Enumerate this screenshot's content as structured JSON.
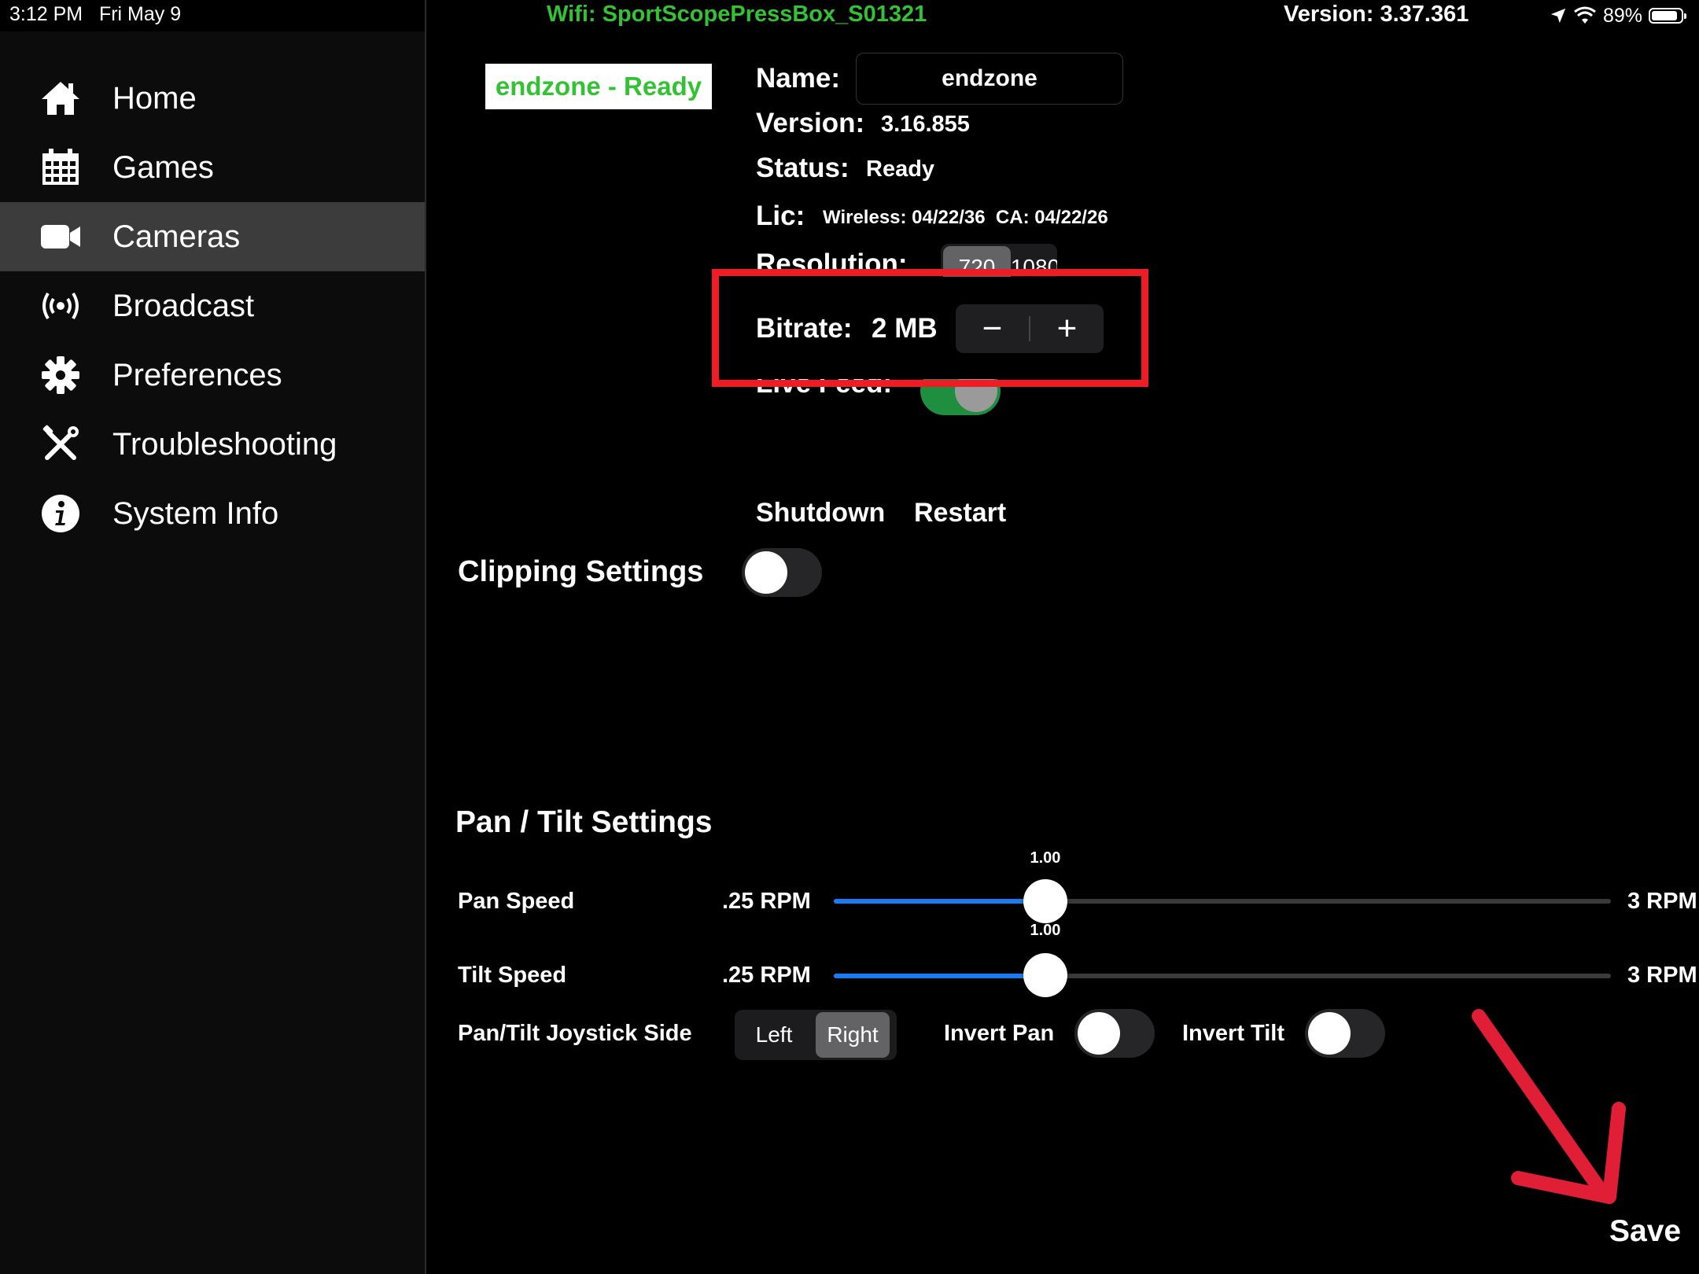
{
  "status_bar": {
    "time": "3:12 PM",
    "date": "Fri May 9",
    "wifi": "Wifi: SportScopePressBox_S01321",
    "version": "Version: 3.37.361",
    "battery": "89%",
    "battery_level": 0.89,
    "icons": [
      "location-arrow-icon",
      "wifi-icon",
      "battery-icon"
    ]
  },
  "sidebar": {
    "items": [
      {
        "label": "Home",
        "icon": "home-icon"
      },
      {
        "label": "Games",
        "icon": "calendar-icon"
      },
      {
        "label": "Cameras",
        "icon": "camera-icon",
        "active": true
      },
      {
        "label": "Broadcast",
        "icon": "broadcast-icon"
      },
      {
        "label": "Preferences",
        "icon": "gear-icon"
      },
      {
        "label": "Troubleshooting",
        "icon": "tools-icon"
      },
      {
        "label": "System Info",
        "icon": "info-icon"
      }
    ]
  },
  "camera": {
    "badge": "endzone - Ready",
    "name_label": "Name:",
    "name_value": "endzone",
    "version_label": "Version:",
    "version_value": "3.16.855",
    "status_label": "Status:",
    "status_value": "Ready",
    "lic_label": "Lic:",
    "lic_value": "Wireless: 04/22/36  CA: 04/22/26",
    "resolution_label": "Resolution:",
    "resolution_options": [
      "720",
      "1080"
    ],
    "resolution_selected": "720",
    "bitrate_label": "Bitrate:",
    "bitrate_value": "2 MB",
    "bitrate_minus": "−",
    "bitrate_plus": "+",
    "live_feed_label": "Live Feed:",
    "live_feed_on": true,
    "shutdown_label": "Shutdown",
    "restart_label": "Restart"
  },
  "clipping": {
    "label": "Clipping Settings",
    "enabled": false
  },
  "pan_tilt": {
    "title": "Pan / Tilt Settings",
    "pan_speed": {
      "label": "Pan Speed",
      "min_label": ".25 RPM",
      "max_label": "3 RPM",
      "value_label": "1.00",
      "value": 1.0,
      "min": 0.25,
      "max": 3
    },
    "tilt_speed": {
      "label": "Tilt Speed",
      "min_label": ".25 RPM",
      "max_label": "3 RPM",
      "value_label": "1.00",
      "value": 1.0,
      "min": 0.25,
      "max": 3
    },
    "joystick_label": "Pan/Tilt Joystick Side",
    "joystick_options": [
      "Left",
      "Right"
    ],
    "joystick_selected": "Right",
    "invert_pan_label": "Invert Pan",
    "invert_pan": false,
    "invert_tilt_label": "Invert Tilt",
    "invert_tilt": false
  },
  "save_label": "Save",
  "colors": {
    "accent_green": "#34c234",
    "slider_blue": "#1a7cf5",
    "annotation_red": "#ee1c24",
    "toggle_on": "#1f8f3f"
  }
}
